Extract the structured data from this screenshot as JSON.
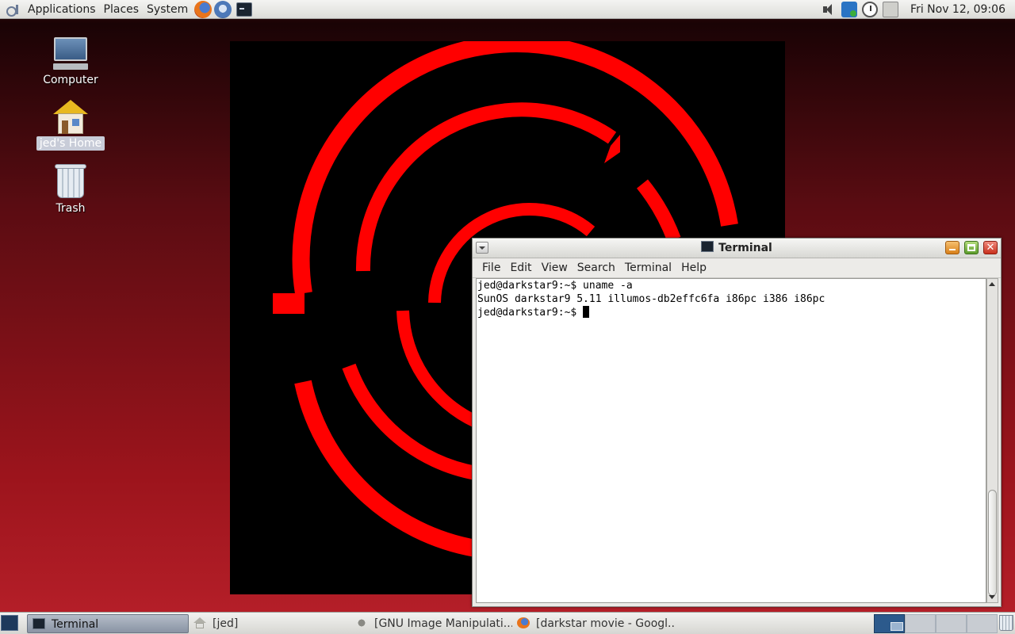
{
  "top_panel": {
    "menus": [
      "Applications",
      "Places",
      "System"
    ],
    "launchers": [
      "firefox-icon",
      "thunderbird-icon",
      "terminal-icon"
    ],
    "tray_icons": [
      "volume-icon",
      "network-icon",
      "clock-icon",
      "update-icon"
    ],
    "clock": "Fri Nov 12, 09:06"
  },
  "desktop": {
    "icons": [
      {
        "label": "Computer",
        "icon": "computer-icon"
      },
      {
        "label": "jed's Home",
        "icon": "home-folder-icon",
        "selected": true
      },
      {
        "label": "Trash",
        "icon": "trash-icon"
      }
    ],
    "wallpaper_colors": {
      "background": "#000000",
      "accent": "#ff0000"
    }
  },
  "terminal": {
    "title": "Terminal",
    "menu": [
      "File",
      "Edit",
      "View",
      "Search",
      "Terminal",
      "Help"
    ],
    "lines": [
      "jed@darkstar9:~$ uname -a",
      "SunOS darkstar9 5.11 illumos-db2effc6fa i86pc i386 i86pc",
      "jed@darkstar9:~$ "
    ],
    "close_glyph": "✕"
  },
  "taskbar": {
    "tasks": [
      {
        "label": "Terminal",
        "active": true,
        "icon": "terminal-icon"
      },
      {
        "label": "[jed]",
        "active": false,
        "icon": "home-folder-icon"
      },
      {
        "label": "[GNU Image Manipulati...",
        "active": false,
        "icon": "gimp-icon"
      },
      {
        "label": "[darkstar movie - Googl...",
        "active": false,
        "icon": "firefox-icon"
      }
    ],
    "workspace_count": 4,
    "active_workspace": 1
  }
}
